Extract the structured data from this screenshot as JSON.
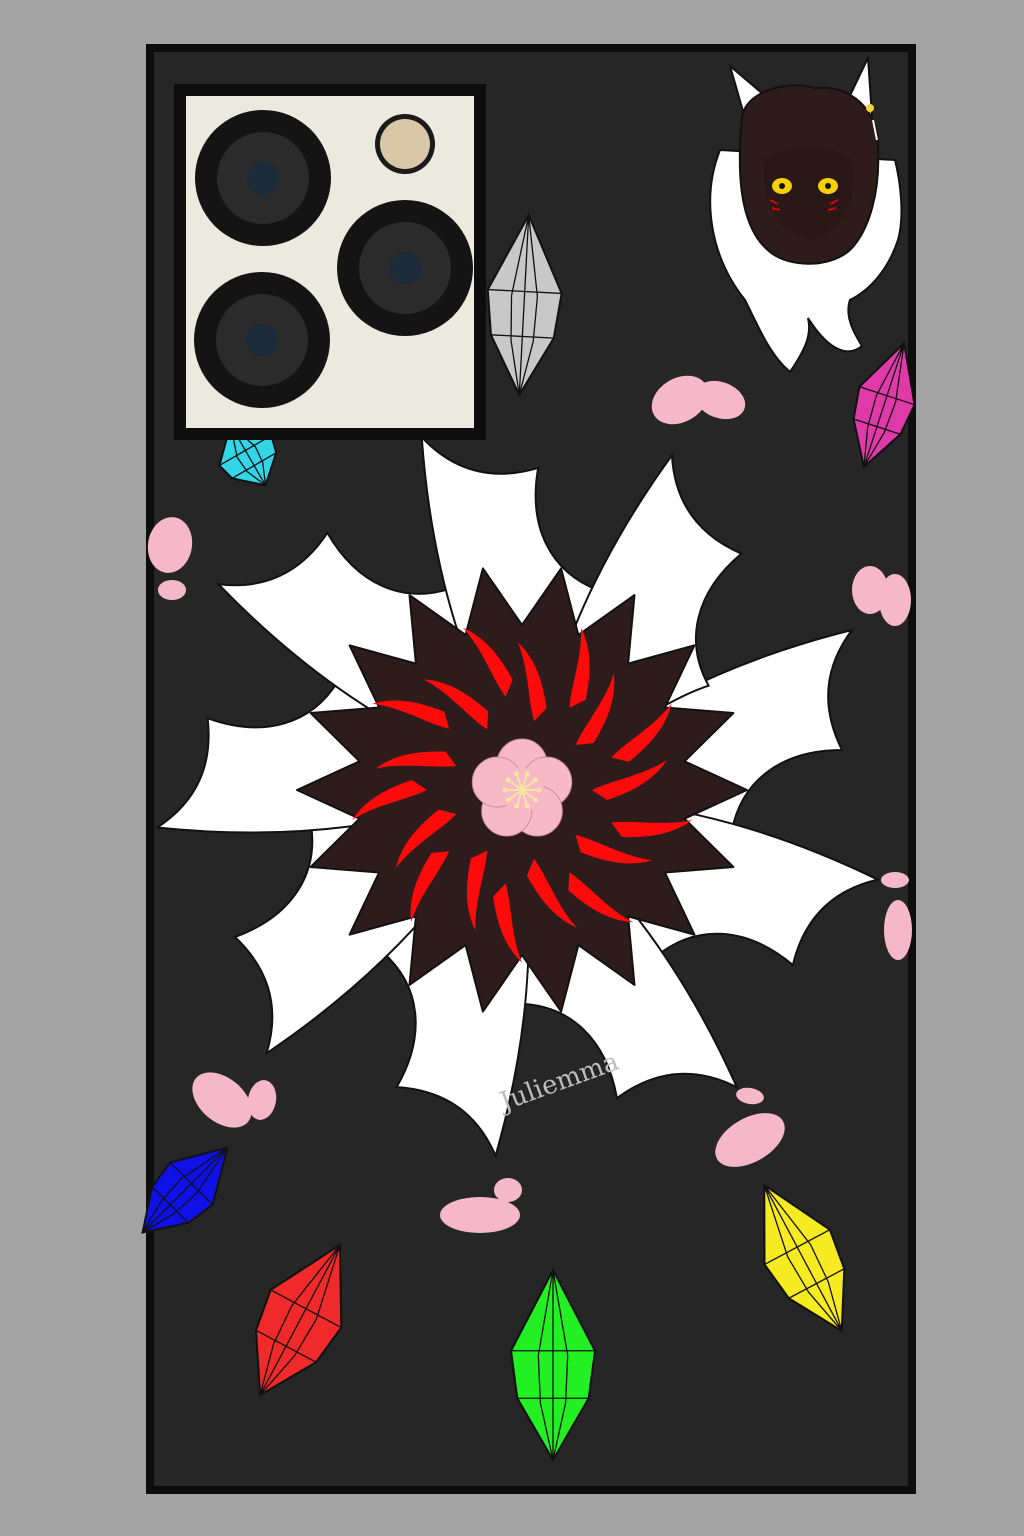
{
  "canvas": {
    "background_color": "#a3a3a3"
  },
  "phone_case": {
    "body_color": "#262626",
    "outline_color": "#0d0d0d"
  },
  "camera_module": {
    "plate_color": "#ece9df",
    "lens_count": 3,
    "lens_outer_color": "#141414",
    "lens_ring_color": "#2b2b2b",
    "lens_glass_color": "#1c2b3a",
    "flash_color": "#d8c8a8",
    "icon": "camera-lens-icon"
  },
  "artwork": {
    "center_motif": "nine-tailed-fox-tail-swirl",
    "tail_color": "#ffffff",
    "inner_fur_color": "#2e1c1c",
    "flame_accent_color": "#ff0a0a",
    "center_flower_color": "#f7b8c8",
    "center_stamen_color": "#f5e6a0",
    "petal_color": "#f5b8ca",
    "sticker": "chibi-cat-girl-sticker",
    "crystals": [
      {
        "name": "gray-crystal",
        "color": "#c8c8c8"
      },
      {
        "name": "magenta-crystal",
        "color": "#e03aa8"
      },
      {
        "name": "cyan-crystal",
        "color": "#32d6e6"
      },
      {
        "name": "blue-crystal",
        "color": "#1010e8"
      },
      {
        "name": "red-crystal",
        "color": "#f02a2a"
      },
      {
        "name": "green-crystal",
        "color": "#22f022"
      },
      {
        "name": "yellow-crystal",
        "color": "#f6ea20"
      }
    ]
  },
  "signature": {
    "text": "Juliemma",
    "color": "#bdbdbd"
  }
}
